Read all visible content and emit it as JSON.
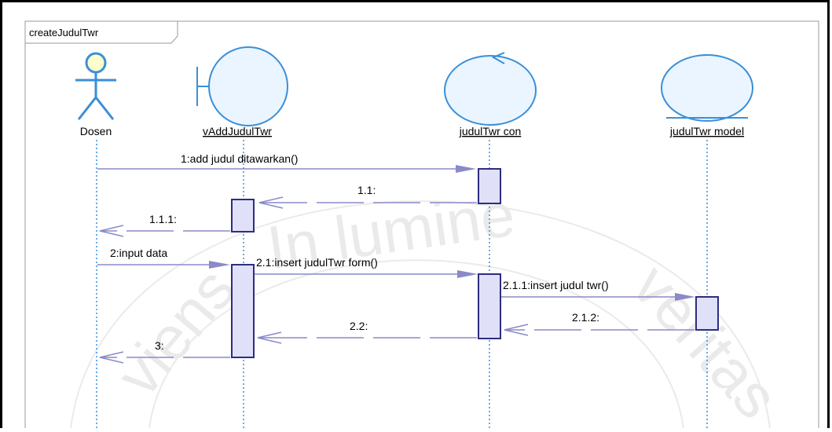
{
  "frame": {
    "title": "createJudulTwr"
  },
  "participants": [
    {
      "id": "dosen",
      "kind": "actor",
      "label": "Dosen"
    },
    {
      "id": "vadd",
      "kind": "boundary",
      "label": "vAddJudulTwr"
    },
    {
      "id": "con",
      "kind": "control",
      "label": "judulTwr con"
    },
    {
      "id": "model",
      "kind": "entity",
      "label": "judulTwr model"
    }
  ],
  "messages": [
    {
      "id": "m1",
      "label": "1:add judul ditawarkan()",
      "from": "dosen",
      "to": "con",
      "type": "call"
    },
    {
      "id": "m1_1",
      "label": "1.1:",
      "from": "con",
      "to": "vadd",
      "type": "return"
    },
    {
      "id": "m1_1_1",
      "label": "1.1.1:",
      "from": "vadd",
      "to": "dosen",
      "type": "return"
    },
    {
      "id": "m2",
      "label": "2:input data",
      "from": "dosen",
      "to": "vadd",
      "type": "call"
    },
    {
      "id": "m2_1",
      "label": "2.1:insert judulTwr form()",
      "from": "vadd",
      "to": "con",
      "type": "call"
    },
    {
      "id": "m2_1_1",
      "label": "2.1.1:insert judul twr()",
      "from": "con",
      "to": "model",
      "type": "call"
    },
    {
      "id": "m2_1_2",
      "label": "2.1.2:",
      "from": "model",
      "to": "con",
      "type": "return"
    },
    {
      "id": "m2_2",
      "label": "2.2:",
      "from": "con",
      "to": "vadd",
      "type": "return"
    },
    {
      "id": "m3",
      "label": "3:",
      "from": "vadd",
      "to": "dosen",
      "type": "return"
    }
  ],
  "watermark": {
    "text": "Universitas Atma Jaya Yogyakarta — In lumine veritas",
    "visible_fragment_1": "In lumine",
    "visible_fragment_2": "veritas",
    "visible_fragment_3": "viens"
  },
  "colors": {
    "lifeline": "#3a8fd8",
    "shape_stroke": "#3a8fd8",
    "shape_fill": "#eaf5ff",
    "actor_head_fill": "#ffffcc",
    "message_line": "#8a8ac8",
    "activation_fill": "#e0e0f8",
    "activation_stroke": "#2d2d80",
    "frame_border": "#9a9a9a",
    "outer_border": "#000000",
    "text": "#000000"
  }
}
